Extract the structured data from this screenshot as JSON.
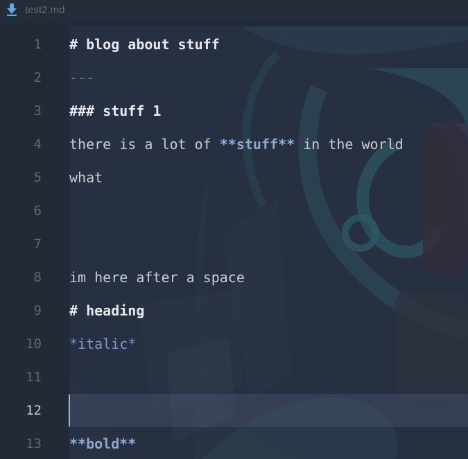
{
  "tab": {
    "icon": "markdown-download-icon",
    "title": "test2.md"
  },
  "colors": {
    "background": "#232a37",
    "text": "#c9ccd4",
    "line_number": "#5d6778",
    "current_line_number": "#c8ccd8",
    "emphasis": "#8fb1e6",
    "caret": "#aeb2d4"
  },
  "editor": {
    "current_line": 12,
    "lines": [
      {
        "num": "1",
        "marker": "# ",
        "text": "blog about stuff"
      },
      {
        "num": "2",
        "text": "---"
      },
      {
        "num": "3",
        "marker": "### ",
        "text": "stuff 1"
      },
      {
        "num": "4",
        "pre": "there is a lot of ",
        "bold_open": "**",
        "bold_text": "stuff",
        "bold_close": "**",
        "post": " in the world"
      },
      {
        "num": "5",
        "text": "what"
      },
      {
        "num": "6",
        "text": ""
      },
      {
        "num": "7",
        "text": ""
      },
      {
        "num": "8",
        "text": "im here after a space"
      },
      {
        "num": "9",
        "marker": "# ",
        "text": "heading"
      },
      {
        "num": "10",
        "text": "*italic*"
      },
      {
        "num": "11",
        "text": ""
      },
      {
        "num": "12",
        "text": ""
      },
      {
        "num": "13",
        "bold_open": "**",
        "bold_text": "bold",
        "bold_close": "**"
      }
    ]
  }
}
